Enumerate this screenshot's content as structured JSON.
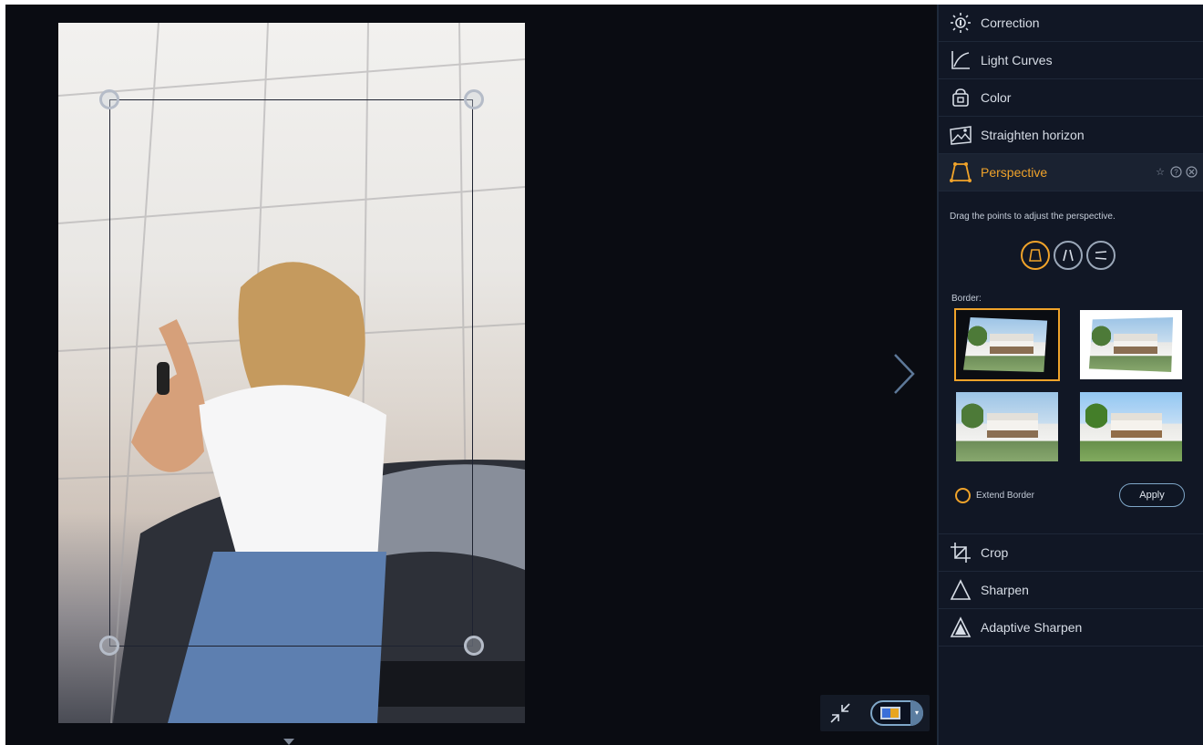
{
  "panel": {
    "tools_top": [
      {
        "label": "Correction",
        "icon": "sun-bulb-icon"
      },
      {
        "label": "Light Curves",
        "icon": "curve-icon"
      },
      {
        "label": "Color",
        "icon": "color-bucket-icon"
      },
      {
        "label": "Straighten horizon",
        "icon": "landscape-icon"
      }
    ],
    "perspective": {
      "label": "Perspective",
      "hint": "Drag the points to adjust the perspective.",
      "border_label": "Border:",
      "extend_label": "Extend Border",
      "apply_label": "Apply",
      "accent": "#f0a32a"
    },
    "tools_bottom": [
      {
        "label": "Crop",
        "icon": "crop-icon"
      },
      {
        "label": "Sharpen",
        "icon": "triangle-outline-icon"
      },
      {
        "label": "Adaptive Sharpen",
        "icon": "triangle-filled-icon"
      }
    ]
  }
}
